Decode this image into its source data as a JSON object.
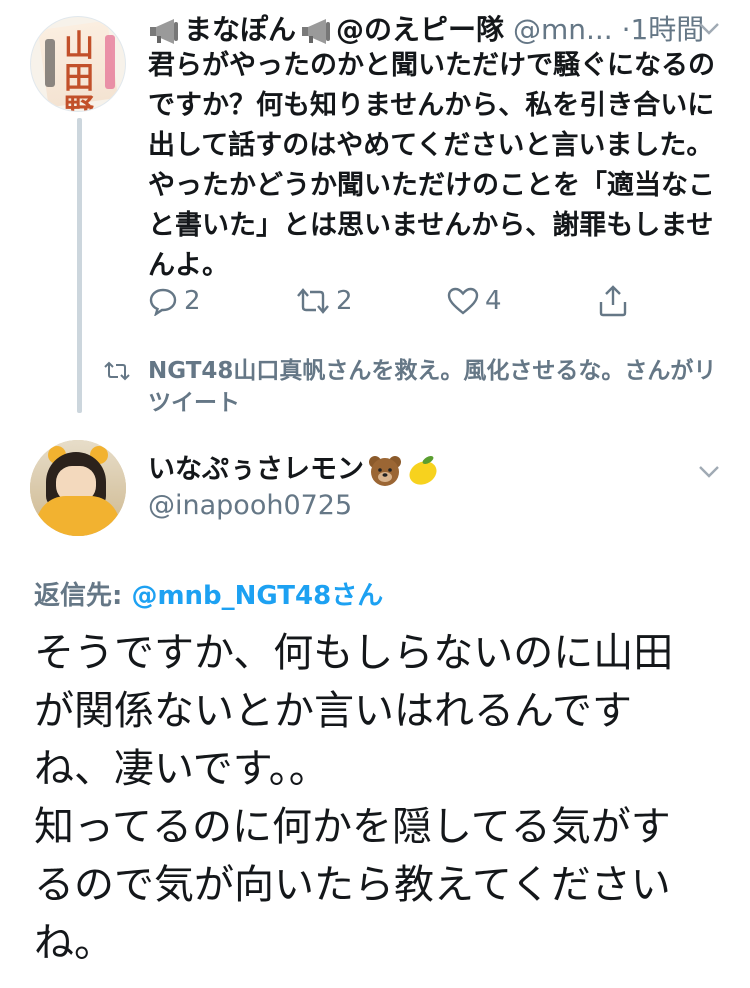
{
  "tweet1": {
    "display_name": "まなぽん",
    "display_name_suffix": "@のえピー隊",
    "handle": "@mn...",
    "separator": "·",
    "time": "1時間",
    "avatar_text": "山田野絵",
    "text": "君らがやったのかと聞いただけで騒ぐになるのですか？何も知りませんから、私を引き合いに出して話すのはやめてくださいと言いました。やったかどうか聞いただけのことを「適当なこと書いた」とは思いませんから、謝罪もしませんよ。",
    "replies": "2",
    "retweets": "2",
    "likes": "4"
  },
  "retweet_notice": "NGT48山口真帆さんを救え。風化させるな。さんがリツイート",
  "tweet2": {
    "display_name": "いなぷぅさレモン",
    "handle": "@inapooh0725",
    "reply_label": "返信先: ",
    "reply_target": "@mnb_NGT48さん",
    "text_lines": [
      "そうですか、何もしらないのに山田",
      "が関係ないとか言いはれるんです",
      "ね、凄いです。。",
      "知ってるのに何かを隠してる気がす",
      "るので気が向いたら教えてください",
      "ね。"
    ]
  },
  "icons": [
    "megaphone-icon",
    "chevron-down-icon",
    "reply-icon",
    "retweet-icon",
    "like-icon",
    "share-icon",
    "bear-icon",
    "lemon-icon"
  ],
  "colors": {
    "link": "#1da1f2",
    "secondary": "#657786",
    "text": "#14171a",
    "thread_line": "#ccd6dd"
  }
}
